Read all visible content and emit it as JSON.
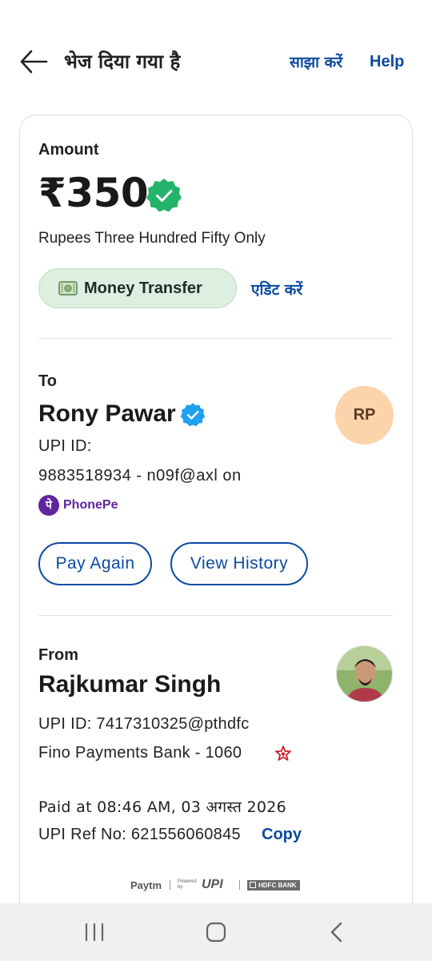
{
  "header": {
    "title": "भेज दिया गया है",
    "share_label": "साझा करें",
    "help_label": "Help"
  },
  "amount": {
    "label": "Amount",
    "value": "₹350",
    "in_words": "Rupees Three Hundred Fifty Only",
    "category_chip": "Money Transfer",
    "edit_label": "एडिट करें"
  },
  "to": {
    "label": "To",
    "name": "Rony Pawar",
    "initials": "RP",
    "upi_line1": "UPI ID:",
    "upi_line2": "9883518934 - n09f@axl on",
    "app_icon_glyph": "पे",
    "app_name": "PhonePe",
    "pay_again_label": "Pay Again",
    "view_history_label": "View History"
  },
  "from": {
    "label": "From",
    "name": "Rajkumar Singh",
    "upi": "UPI ID: 7417310325@pthdfc",
    "bank": "Fino Payments Bank - 1060",
    "paid_at": "Paid at 08:46 AM, 03 अगस्त 2026",
    "ref": "UPI Ref No: 621556060845",
    "copy_label": "Copy"
  },
  "footer": {
    "paytm": "Paytm",
    "powered_by": "Powered by",
    "upi": "UPI",
    "bank": "HDFC BANK"
  },
  "colors": {
    "accent_blue": "#0b4aa2",
    "verified_green": "#24b36b",
    "verified_blue": "#1ea1f1",
    "chip_bg": "#dcefe1",
    "avatar_bg": "#fbd4ab",
    "phonepe_purple": "#5f259f"
  },
  "icons": {
    "back": "left-arrow-icon",
    "verified": "verified-badge-icon",
    "money": "banknote-icon",
    "bank": "fino-bank-icon",
    "nav_recent": "recent-apps-icon",
    "nav_home": "home-icon",
    "nav_back": "nav-back-icon"
  }
}
